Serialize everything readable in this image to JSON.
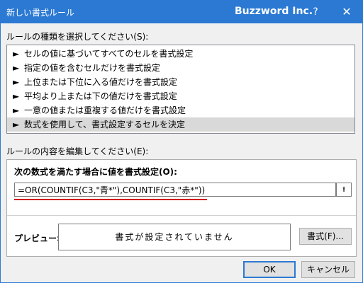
{
  "window": {
    "title": "新しい書式ルール",
    "brand": "Buzzword Inc.",
    "help_label": "?",
    "close_label": "✕"
  },
  "rule_type": {
    "label": "ルールの種類を選択してください(S):",
    "items": [
      {
        "label": "セルの値に基づいてすべてのセルを書式設定"
      },
      {
        "label": "指定の値を含むセルだけを書式設定"
      },
      {
        "label": "上位または下位に入る値だけを書式設定"
      },
      {
        "label": "平均より上または下の値だけを書式設定"
      },
      {
        "label": "一意の値または重複する値だけを書式設定"
      },
      {
        "label": "数式を使用して、書式設定するセルを決定"
      }
    ],
    "selected_index": 5,
    "arrow_glyph": "►"
  },
  "rule_content": {
    "label": "ルールの内容を編集してください(E):",
    "formula_label": "次の数式を満たす場合に値を書式設定(O):",
    "formula_value": "=OR(COUNTIF(C3,\"青*\"),COUNTIF(C3,\"赤*\"))",
    "collapse_icon_glyph": "⭱",
    "preview_label": "プレビュー:",
    "preview_text": "書式が設定されていません",
    "format_button_label": "書式(F)..."
  },
  "footer": {
    "ok_label": "OK",
    "cancel_label": "キャンセル"
  },
  "colors": {
    "accent": "#2b79d3",
    "underline": "#d00000",
    "selection": "#d9d9d9"
  }
}
